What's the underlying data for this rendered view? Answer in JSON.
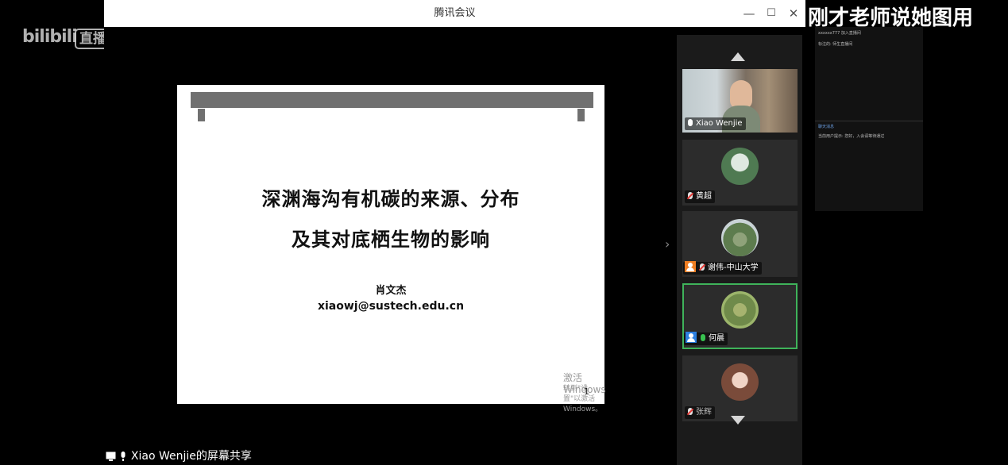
{
  "watermark": {
    "logo": "bilibili",
    "live_badge": "直播"
  },
  "window": {
    "title": "腾讯会议",
    "controls": {
      "minimize": "—",
      "maximize": "☐",
      "close": "✕"
    }
  },
  "slide": {
    "title_line1": "深渊海沟有机碳的来源、分布",
    "title_line2": "及其对底栖生物的影响",
    "author": "肖文杰",
    "email": "xiaowj@sustech.edu.cn",
    "activation_main": "激活 Windows",
    "activation_sub": "转到\"设置\"以激活 Windows。",
    "page_number": "1"
  },
  "share_label": "Xiao Wenjie的屏幕共享",
  "panel": {
    "collapse_glyph": "›",
    "participants": [
      {
        "name": "Xiao Wenjie",
        "mic": "on"
      },
      {
        "name": "黄超",
        "mic": "muted"
      },
      {
        "name": "谢伟-中山大学",
        "mic": "muted"
      },
      {
        "name": "何晨",
        "mic": "speaking"
      },
      {
        "name": "张辉",
        "mic": "muted"
      }
    ]
  },
  "overlay": {
    "caption": "刚才老师说她图用",
    "chat_lines": [
      "xxxxxx777 加入直播间",
      "标注的: 师生直播间",
      "聊天消息",
      "当前用户提示: 您好，入会请等待通过"
    ]
  },
  "colors": {
    "active_speaker": "#3fb35a",
    "muted_mic": "#e53935",
    "host_badge": "#ee7d22",
    "user_badge": "#2b7fe0"
  }
}
